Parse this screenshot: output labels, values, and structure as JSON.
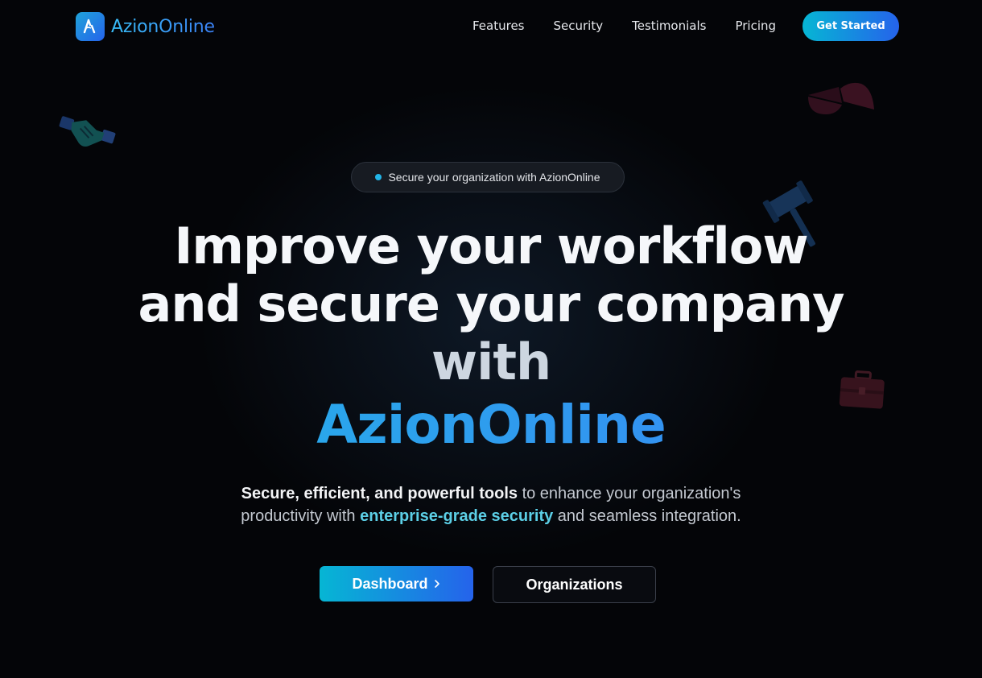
{
  "brand": {
    "name": "AzionOnline",
    "colors": {
      "accent_start": "#06b6d4",
      "accent_end": "#2563eb",
      "background": "#040508"
    }
  },
  "nav": {
    "links": [
      "Features",
      "Security",
      "Testimonials",
      "Pricing"
    ],
    "cta_label": "Get Started"
  },
  "hero": {
    "badge_text": "Secure your organization with AzionOnline",
    "headline_line1": "Improve your workflow",
    "headline_line2": "and secure your company",
    "headline_line3": "with",
    "headline_brand": "AzionOnline",
    "sub_strong": "Secure, efficient, and powerful tools",
    "sub_part1": " to enhance your organization's productivity with ",
    "sub_accent": "enterprise-grade security",
    "sub_part2": " and seamless integration.",
    "primary_button": "Dashboard",
    "primary_button_icon": "chevron-right-icon",
    "secondary_button": "Organizations"
  },
  "decorations": [
    "handshake-icon",
    "pie-chart-icon",
    "gavel-icon",
    "briefcase-icon"
  ]
}
